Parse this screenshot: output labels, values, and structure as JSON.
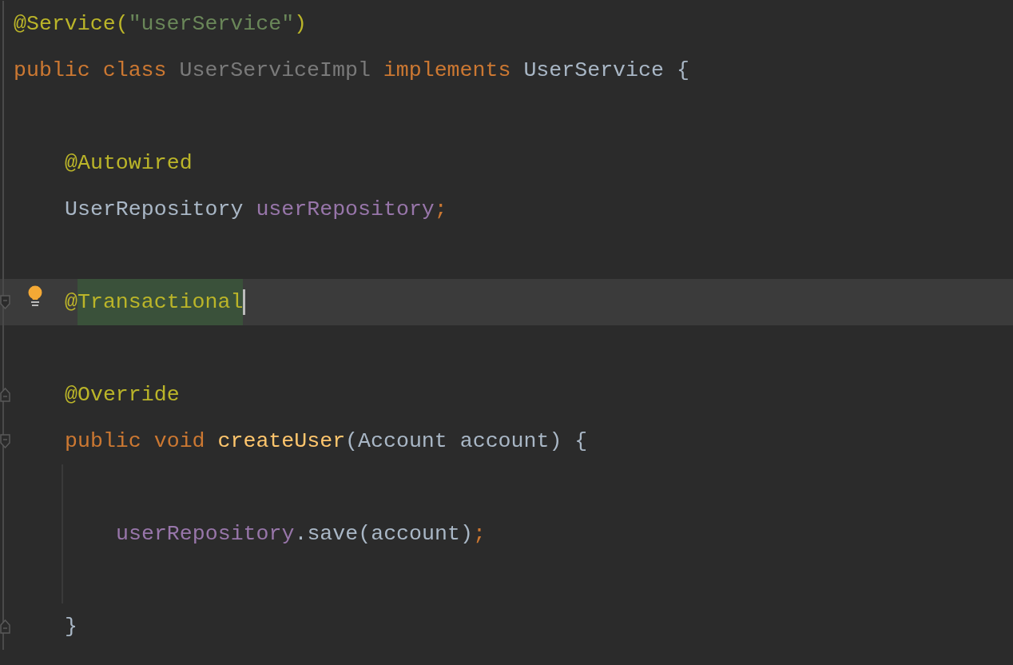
{
  "editor": {
    "lines": [
      {
        "kind": "code",
        "tokens": [
          {
            "text": "@Service(",
            "kind": "annotation"
          },
          {
            "text": "\"userService\"",
            "kind": "string"
          },
          {
            "text": ")",
            "kind": "annotation"
          }
        ]
      },
      {
        "kind": "code",
        "tokens": [
          {
            "text": "public class ",
            "kind": "keyword"
          },
          {
            "text": "UserServiceImpl",
            "kind": "unused"
          },
          {
            "text": " implements ",
            "kind": "keyword"
          },
          {
            "text": "UserService {",
            "kind": "plain"
          }
        ],
        "children": [
          {
            "kind": "blank"
          },
          {
            "kind": "code",
            "tokens": [
              {
                "text": "@Autowired",
                "kind": "annotation"
              }
            ]
          },
          {
            "kind": "code",
            "tokens": [
              {
                "text": "UserRepository ",
                "kind": "plain"
              },
              {
                "text": "userRepository",
                "kind": "field"
              },
              {
                "text": ";",
                "kind": "keyword"
              }
            ]
          },
          {
            "kind": "blank"
          },
          {
            "kind": "code",
            "current": true,
            "caret": true,
            "intention": true,
            "fold_open": true,
            "tokens": [
              {
                "text": "@",
                "kind": "annotation"
              },
              {
                "text": "Transactional",
                "kind": "annotation",
                "highlighted": true
              }
            ]
          },
          {
            "kind": "blank"
          },
          {
            "kind": "code",
            "fold_close": true,
            "tokens": [
              {
                "text": "@Override",
                "kind": "annotation"
              }
            ]
          },
          {
            "kind": "code",
            "fold_open": true,
            "tokens": [
              {
                "text": "public void ",
                "kind": "keyword"
              },
              {
                "text": "createUser",
                "kind": "method"
              },
              {
                "text": "(Account account) {",
                "kind": "plain"
              }
            ],
            "children": [
              {
                "kind": "blank"
              },
              {
                "kind": "code",
                "tokens": [
                  {
                    "text": "userRepository",
                    "kind": "field"
                  },
                  {
                    "text": ".save(account)",
                    "kind": "plain"
                  },
                  {
                    "text": ";",
                    "kind": "keyword"
                  }
                ]
              },
              {
                "kind": "blank"
              }
            ]
          },
          {
            "kind": "code",
            "fold_close": true,
            "tokens": [
              {
                "text": "}",
                "kind": "plain"
              }
            ]
          }
        ]
      }
    ]
  }
}
